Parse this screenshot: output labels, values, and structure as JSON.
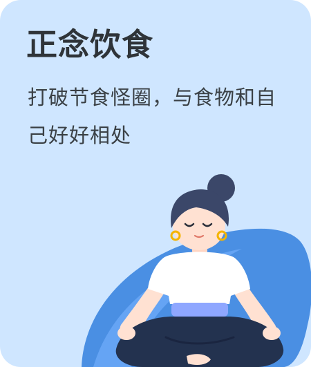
{
  "card": {
    "title": "正念饮食",
    "subtitle": "打破节食怪圈，与食物和自己好好相处",
    "illustration": "meditating-woman-illustration"
  },
  "colors": {
    "card_background": "#cfe6ff",
    "blob": "#4a8fe3",
    "blob_light": "#78b3ff",
    "hair": "#3b4769",
    "skin": "#ffe1d2",
    "shirt": "#ffffff",
    "waistband": "#8fa7ff",
    "pants": "#23324f",
    "earring": "#f4b400"
  }
}
